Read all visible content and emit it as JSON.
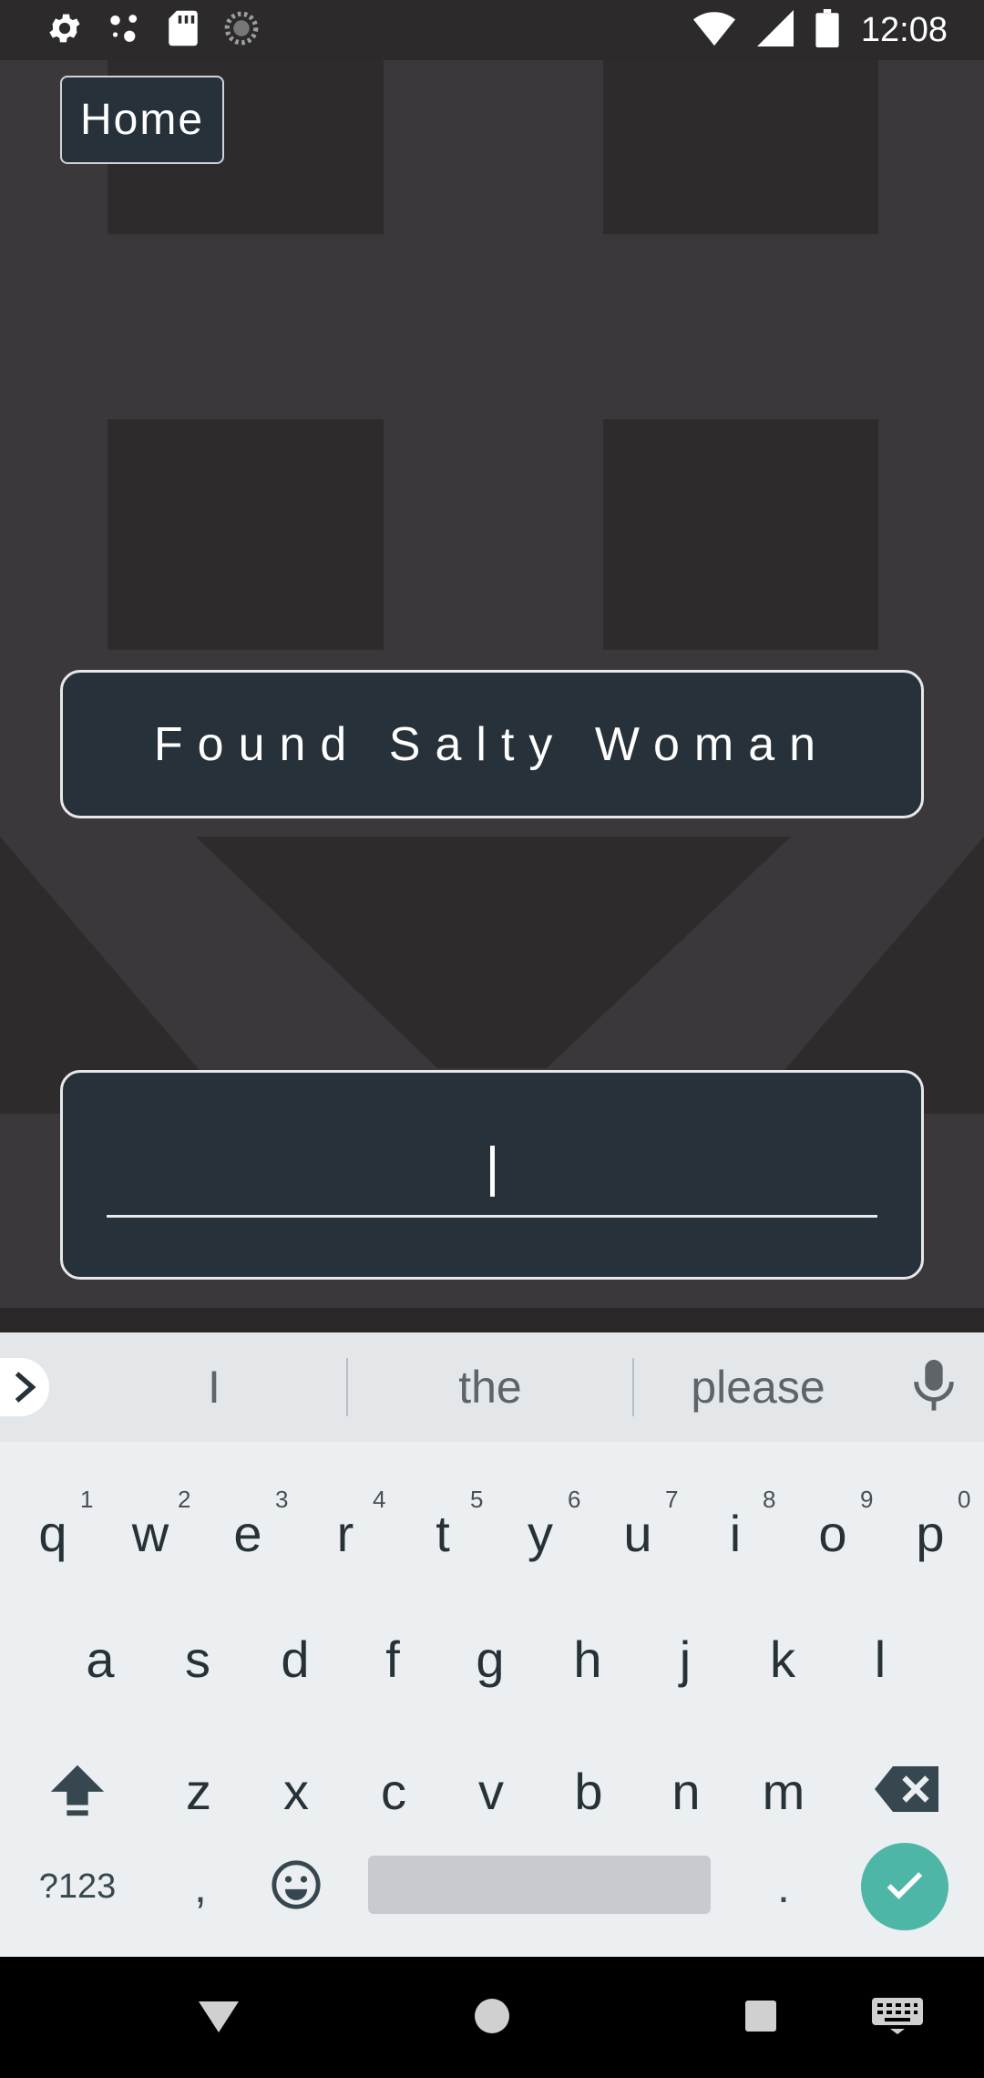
{
  "status_bar": {
    "time": "12:08",
    "left_icons": [
      "settings-icon",
      "network-dots-icon",
      "sd-card-icon",
      "sync-icon"
    ],
    "right_icons": [
      "wifi-icon",
      "cell-signal-icon",
      "battery-icon"
    ]
  },
  "header": {
    "home_label": "Home"
  },
  "main": {
    "title": "Found Salty Woman",
    "input": {
      "value": ""
    }
  },
  "keyboard": {
    "suggestions": [
      "I",
      "the",
      "please"
    ],
    "rows": [
      [
        {
          "k": "q",
          "h": "1"
        },
        {
          "k": "w",
          "h": "2"
        },
        {
          "k": "e",
          "h": "3"
        },
        {
          "k": "r",
          "h": "4"
        },
        {
          "k": "t",
          "h": "5"
        },
        {
          "k": "y",
          "h": "6"
        },
        {
          "k": "u",
          "h": "7"
        },
        {
          "k": "i",
          "h": "8"
        },
        {
          "k": "o",
          "h": "9"
        },
        {
          "k": "p",
          "h": "0"
        }
      ],
      [
        {
          "k": "a"
        },
        {
          "k": "s"
        },
        {
          "k": "d"
        },
        {
          "k": "f"
        },
        {
          "k": "g"
        },
        {
          "k": "h"
        },
        {
          "k": "j"
        },
        {
          "k": "k"
        },
        {
          "k": "l"
        }
      ],
      [
        {
          "k": "z"
        },
        {
          "k": "x"
        },
        {
          "k": "c"
        },
        {
          "k": "v"
        },
        {
          "k": "b"
        },
        {
          "k": "n"
        },
        {
          "k": "m"
        }
      ]
    ],
    "symbols_label": "?123",
    "comma": ",",
    "period": ".",
    "accent_color": "#4db6a6"
  },
  "nav_bar": {
    "icons": [
      "back-icon",
      "home-icon",
      "recents-icon",
      "keyboard-switch-icon"
    ]
  }
}
